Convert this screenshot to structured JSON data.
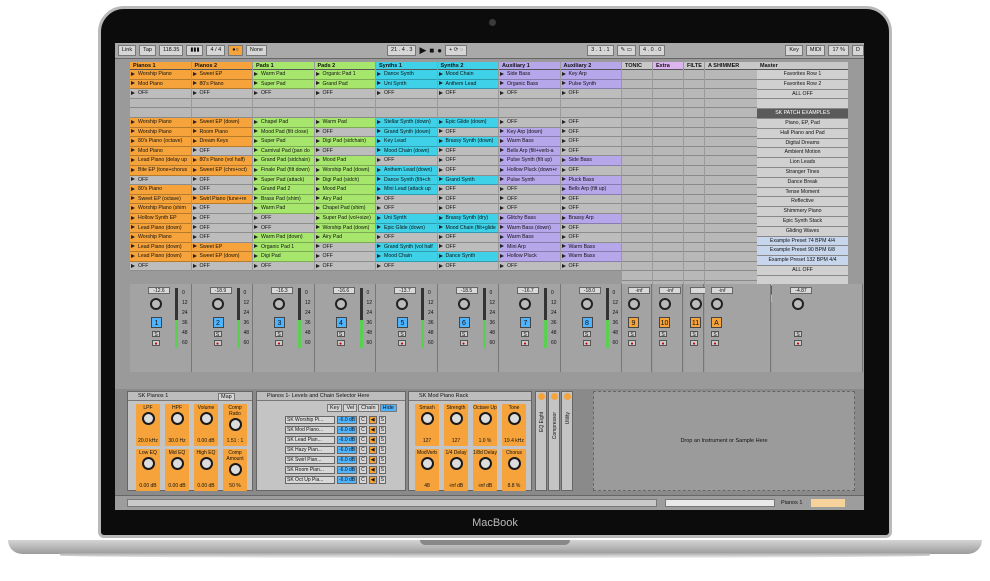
{
  "laptop_brand": "MacBook",
  "transport": {
    "link": "Link",
    "tap": "Tap",
    "tempo": "118.35",
    "signature": "4 / 4",
    "quant": "1 Bar",
    "none": "None",
    "position": "21 . 4 . 3",
    "loop_start": "3 . 1 . 1",
    "loop_len": "4 . 0 . 0",
    "key": "Key",
    "midi": "MIDI",
    "cpu": "17 %",
    "d": "D"
  },
  "tracks": [
    {
      "name": "Pianos 1",
      "color": "#f5a33a",
      "number": "1",
      "vol": "-12.6",
      "clips": [
        "Worship Piano",
        "Mod Piano",
        "OFF",
        "",
        "",
        "Worship Piano",
        "Worship Piano",
        "80's Piano (octave)",
        "Mod Piano",
        "Lead Piano (delay up",
        "Bite EP (tone+chorus",
        "OFF",
        "80's Piano",
        "Sweet EP (octave)",
        "Worship Piano (shim",
        "Hollow Synth EP",
        "Lead Piano (down)",
        "Worship Piano",
        "Lead Piano (down)",
        "Lead Piano (down)",
        "OFF"
      ]
    },
    {
      "name": "Pianos 2",
      "color": "#f5a33a",
      "number": "2",
      "vol": "-18.9",
      "clips": [
        "Sweet EP",
        "80's Piano",
        "OFF",
        "",
        "",
        "Sweet EP (down)",
        "Room Piano",
        "Dream Keys",
        "OFF",
        "80's Piano (vol half)",
        "Sweet EP (chrs+oct)",
        "OFF",
        "OFF",
        "Swirl Piano (tune+re",
        "OFF",
        "OFF",
        "OFF",
        "OFF",
        "Sweet EP",
        "Sweet EP (down)",
        "OFF"
      ]
    },
    {
      "name": "Pads 1",
      "color": "#a6e66d",
      "number": "3",
      "vol": "-16.3",
      "clips": [
        "Warm Pad",
        "Super Pad",
        "OFF",
        "",
        "",
        "Chapel Pad",
        "Mood Pad (filt close)",
        "Super Pad",
        "Carnival Pad (pan do",
        "Grand Pad (sidchain)",
        "Finale Pad (filt down)",
        "Super Pad (attack)",
        "Grand Pad 2",
        "Brass Pad (shim)",
        "Warm Pad",
        "OFF",
        "OFF",
        "Warm Pad (down)",
        "Organic Pad 1",
        "Digi Pad",
        "OFF"
      ]
    },
    {
      "name": "Pads 2",
      "color": "#a6e66d",
      "number": "4",
      "vol": "-16.6",
      "clips": [
        "Organic Pad 1",
        "Grand Pad",
        "OFF",
        "",
        "",
        "Warm Pad",
        "OFF",
        "Digi Pad (sidchain)",
        "OFF",
        "Mood Pad",
        "Worship Pad (down)",
        "Digi Pad (sidch)",
        "Mood Pad",
        "Airy Pad",
        "Chapel Pad (shim)",
        "Super Pad (vol+size)",
        "Worship Pad (down)",
        "Airy Pad",
        "OFF",
        "OFF",
        "OFF"
      ]
    },
    {
      "name": "Synths 1",
      "color": "#3ed1e8",
      "number": "5",
      "vol": "-13.7",
      "clips": [
        "Dance Synth",
        "Uni Synth",
        "OFF",
        "",
        "",
        "Stellar Synth (down)",
        "Grand Synth (down)",
        "Key Lead",
        "Mood Chain (down)",
        "OFF",
        "Anthem Lead (down)",
        "Dance Synth (filt+ch",
        "Mini Lead (attack up",
        "OFF",
        "OFF",
        "Uni Synth",
        "Epic Glide (down)",
        "OFF",
        "Grand Synth (vol half",
        "Mood Chain",
        "OFF"
      ]
    },
    {
      "name": "Synths 2",
      "color": "#3ed1e8",
      "number": "6",
      "vol": "-18.5",
      "clips": [
        "Mood Chain",
        "Anthem Lead",
        "OFF",
        "",
        "",
        "Epic Glide (down)",
        "OFF",
        "Brassy Synth (down)",
        "OFF",
        "OFF",
        "OFF",
        "Grand Synth",
        "OFF",
        "OFF",
        "OFF",
        "Brassy Synth (dry)",
        "Mood Chain (filt+glide",
        "OFF",
        "OFF",
        "Dance Synth",
        "OFF"
      ]
    },
    {
      "name": "Auxiliary 1",
      "color": "#b6a6ea",
      "number": "7",
      "vol": "-16.7",
      "clips": [
        "Side Bass",
        "Organic Bass",
        "OFF",
        "",
        "",
        "OFF",
        "Key Arp (down)",
        "Warm Bass",
        "Bells Arp (filt+verb-a",
        "Pulse Synth (filt up)",
        "Hollow Pluck (down+r",
        "Pulse Synth",
        "OFF",
        "OFF",
        "OFF",
        "Glitchy Bass",
        "Warm Bass (down)",
        "Warm Bass",
        "Mini Arp",
        "Hollow Pluck",
        "OFF"
      ]
    },
    {
      "name": "Auxiliary 2",
      "color": "#b6a6ea",
      "number": "8",
      "vol": "-18.0",
      "clips": [
        "Key Arp",
        "Pulse Synth",
        "OFF",
        "",
        "",
        "OFF",
        "OFF",
        "OFF",
        "OFF",
        "Side Bass",
        "OFF",
        "Pluck Bass",
        "Bells Arp (filt up)",
        "OFF",
        "OFF",
        "Brassy Arp",
        "OFF",
        "OFF",
        "Warm Bass",
        "Warm Bass",
        "OFF"
      ]
    }
  ],
  "extra_tracks": [
    {
      "name": "TONIC",
      "number": "9",
      "vol": "-inf"
    },
    {
      "name": "Extra",
      "number": "10",
      "vol": "-inf"
    },
    {
      "name": "FILTE",
      "number": "11",
      "vol": ""
    },
    {
      "name": "A SHIMMER",
      "number": "A",
      "vol": "-inf"
    }
  ],
  "master": {
    "name": "Master",
    "vol": "-4.87",
    "rows": [
      "Favorites Row 1",
      "Favorites Row 2",
      "ALL OFF",
      "",
      "SK PATCH EXAMPLES",
      "Piano, EP, Pad",
      "Hall Piano and Pad",
      "Digital Dreams",
      "Ambient Motion",
      "Lion Leads",
      "Stranger Tines",
      "Dance Break",
      "Tense Moment",
      "Reflective",
      "Shimmery Piano",
      "Epic Synth Stack",
      "Gliding Waves",
      "Example Preset 74 BPM 4/4",
      "Example Preset 90 BPM 6/8",
      "Example Preset 132 BPM 4/4",
      "ALL OFF",
      "",
      "SUNDAY KEYS PRESETS"
    ]
  },
  "meter_scale": [
    "0",
    "12",
    "24",
    "36",
    "48",
    "60"
  ],
  "devices": {
    "rack1": {
      "title": "SK Pianos 1",
      "map": "Map",
      "macros": [
        {
          "label": "LPF",
          "value": "20.0 kHz"
        },
        {
          "label": "HPF",
          "value": "30.0 Hz"
        },
        {
          "label": "Volume",
          "value": "0.00 dB"
        },
        {
          "label": "Comp Ratio",
          "value": "1.51 : 1"
        },
        {
          "label": "Low EQ",
          "value": "0.00 dB"
        },
        {
          "label": "Mid EQ",
          "value": "0.00 dB"
        },
        {
          "label": "High EQ",
          "value": "0.00 dB"
        },
        {
          "label": "Comp Amount",
          "value": "50 %"
        }
      ]
    },
    "chain_selector": {
      "title": "Pianos 1- Levels and Chain Selector Here",
      "tabs": [
        "Key",
        "Vel",
        "Chain",
        "Hide"
      ],
      "chains": [
        {
          "name": "SK Worship Pi...",
          "db": "-6.0 dB"
        },
        {
          "name": "SK Mod Piano...",
          "db": "-6.0 dB"
        },
        {
          "name": "SK Lead Pian...",
          "db": "-6.0 dB"
        },
        {
          "name": "SK Hazy Pian...",
          "db": "-6.0 dB"
        },
        {
          "name": "SK Swirl Pian...",
          "db": "-6.0 dB"
        },
        {
          "name": "SK Room Pian...",
          "db": "-6.0 dB"
        },
        {
          "name": "SK Oct Up Pia...",
          "db": "-6.0 dB"
        }
      ]
    },
    "rack2": {
      "title": "SK Mod Piano Rack",
      "macros": [
        {
          "label": "Smash",
          "value": "127"
        },
        {
          "label": "Strength",
          "value": "127"
        },
        {
          "label": "Octave Up",
          "value": "1.0 %"
        },
        {
          "label": "Tone",
          "value": "19.4 kHz"
        },
        {
          "label": "ModVerb",
          "value": "48"
        },
        {
          "label": "1/4 Delay",
          "value": "-inf dB"
        },
        {
          "label": "1/8d Delay",
          "value": "-inf dB"
        },
        {
          "label": "Chorus",
          "value": "8.8 %"
        }
      ]
    },
    "fx": [
      "EQ Eight",
      "Compressor",
      "Utility"
    ],
    "drop_hint": "Drop an Instrument or Sample Here"
  },
  "status": {
    "track": "Pianos 1"
  }
}
